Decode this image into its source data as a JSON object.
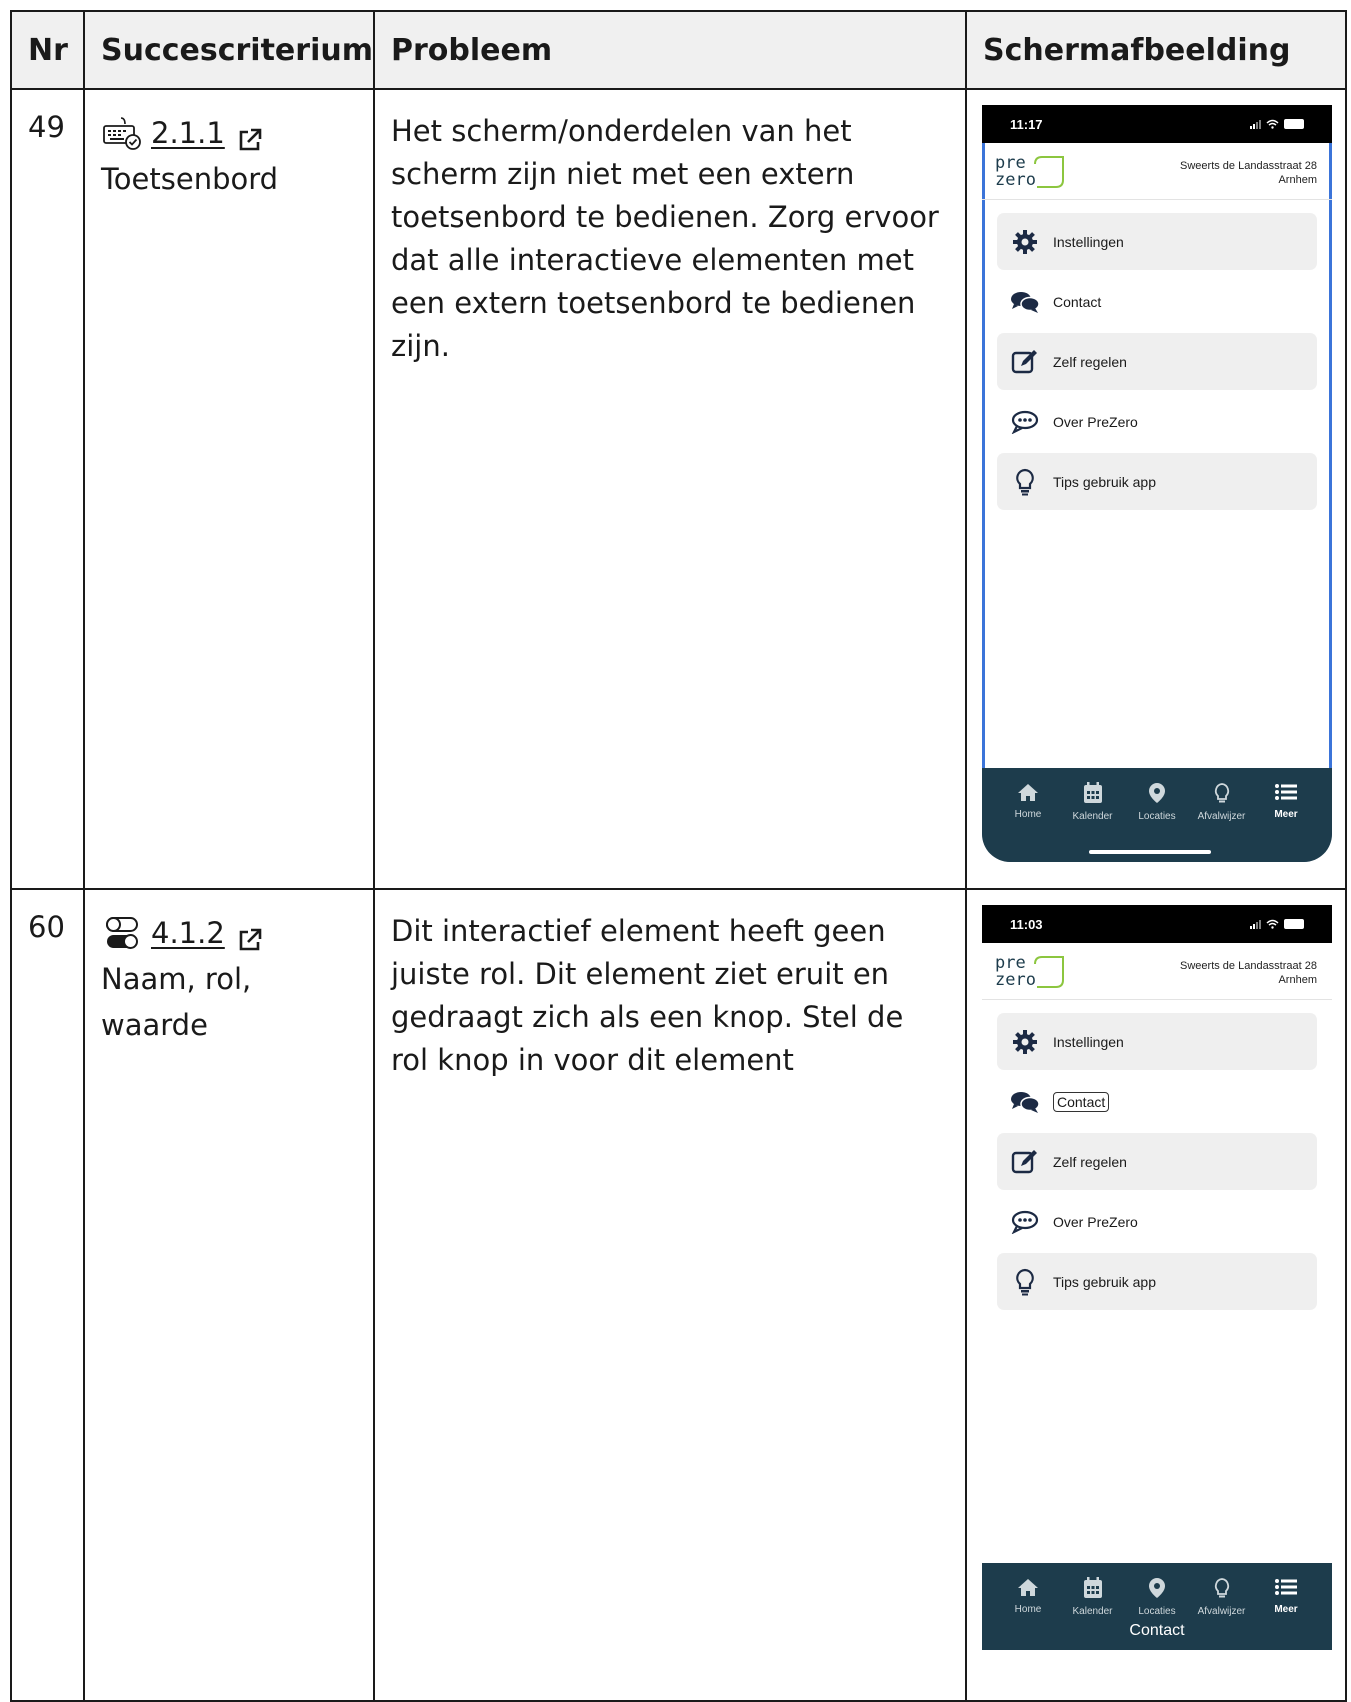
{
  "header": {
    "nr": "Nr",
    "criterion": "Succescriterium",
    "problem": "Probleem",
    "screenshot": "Schermafbeelding"
  },
  "rows": [
    {
      "nr": "49",
      "criterion_code": "2.1.1",
      "criterion_name": "Toetsenbord",
      "criterion_icon": "keyboard-check-icon",
      "problem": "Het scherm/onderdelen van het scherm zijn niet met een extern toetsenbord te bedienen. Zorg ervoor dat alle interactieve elementen met een extern toetsenbord te bedienen zijn.",
      "phone": {
        "time": "11:17",
        "address_line1": "Sweerts de Landasstraat 28",
        "address_line2": "Arnhem",
        "menu": [
          "Instellingen",
          "Contact",
          "Zelf regelen",
          "Over PreZero",
          "Tips gebruik app"
        ],
        "tabs": [
          "Home",
          "Kalender",
          "Locaties",
          "Afvalwijzer",
          "Meer"
        ]
      }
    },
    {
      "nr": "60",
      "criterion_code": "4.1.2",
      "criterion_name": "Naam, rol, waarde",
      "criterion_icon": "toggle-switch-icon",
      "problem": "Dit interactief element heeft geen juiste rol. Dit element ziet eruit en gedraagt zich als een knop. Stel de rol knop in voor dit element",
      "phone": {
        "time": "11:03",
        "address_line1": "Sweerts de Landasstraat 28",
        "address_line2": "Arnhem",
        "menu": [
          "Instellingen",
          "Contact",
          "Zelf regelen",
          "Over PreZero",
          "Tips gebruik app"
        ],
        "tabs": [
          "Home",
          "Kalender",
          "Locaties",
          "Afvalwijzer",
          "Meer"
        ],
        "caption": "Contact"
      }
    }
  ],
  "logo": {
    "line1": "pre",
    "line2": "zero"
  },
  "colors": {
    "tabbar": "#1d3c4c",
    "focus_border": "#3b74d9",
    "logo_green": "#8cc63f",
    "logo_navy": "#1d3c4c",
    "icon_navy": "#1c2a44"
  }
}
